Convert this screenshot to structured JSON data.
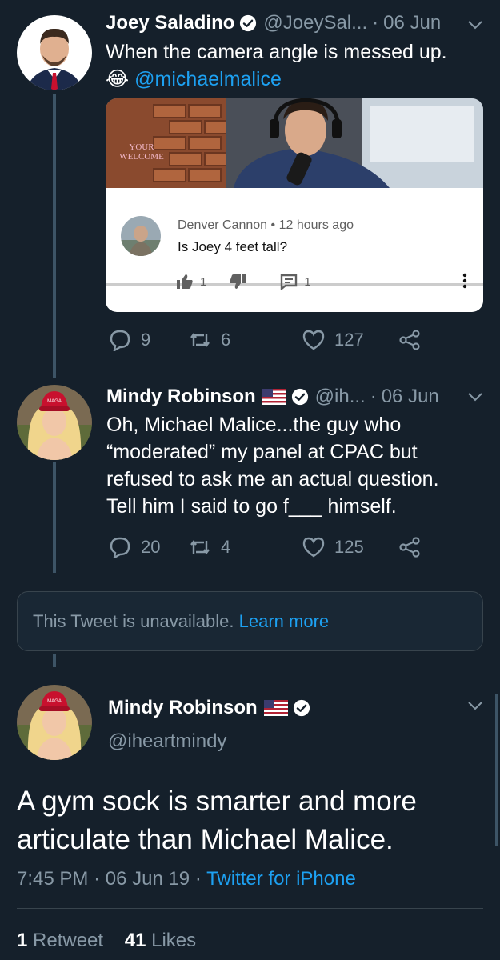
{
  "tweet1": {
    "name": "Joey Saladino",
    "handle": "@JoeySal...",
    "date": "06 Jun",
    "text_line1": "When the camera angle is messed up.",
    "emoji": "😂",
    "mention": "@michaelmalice",
    "media": {
      "sign_text": "YOUR WELCOME",
      "comment_author": "Denver Cannon",
      "comment_time": "12 hours ago",
      "comment_text": "Is Joey 4 feet tall?",
      "likes": "1",
      "replies": "1"
    },
    "replies": "9",
    "retweets": "6",
    "likes": "127"
  },
  "tweet2": {
    "name": "Mindy Robinson",
    "handle": "@ih...",
    "date": "06 Jun",
    "lines": [
      "Oh, Michael Malice...the guy who",
      "“moderated” my panel at CPAC but",
      "refused to ask me an actual question.",
      "Tell him I said to go f___ himself."
    ],
    "replies": "20",
    "retweets": "4",
    "likes": "125"
  },
  "unavailable": {
    "text": "This Tweet is unavailable.",
    "link": "Learn more"
  },
  "main": {
    "name": "Mindy Robinson",
    "handle": "@iheartmindy",
    "text": "A gym sock is smarter and more articulate than Michael Malice.",
    "time": "7:45 PM",
    "date": "06 Jun 19",
    "source": "Twitter for iPhone",
    "retweet_count": "1",
    "retweet_label": "Retweet",
    "like_count": "41",
    "like_label": "Likes"
  },
  "colors": {
    "background": "#15202b",
    "accent": "#1da1f2",
    "muted": "#8899a6"
  }
}
